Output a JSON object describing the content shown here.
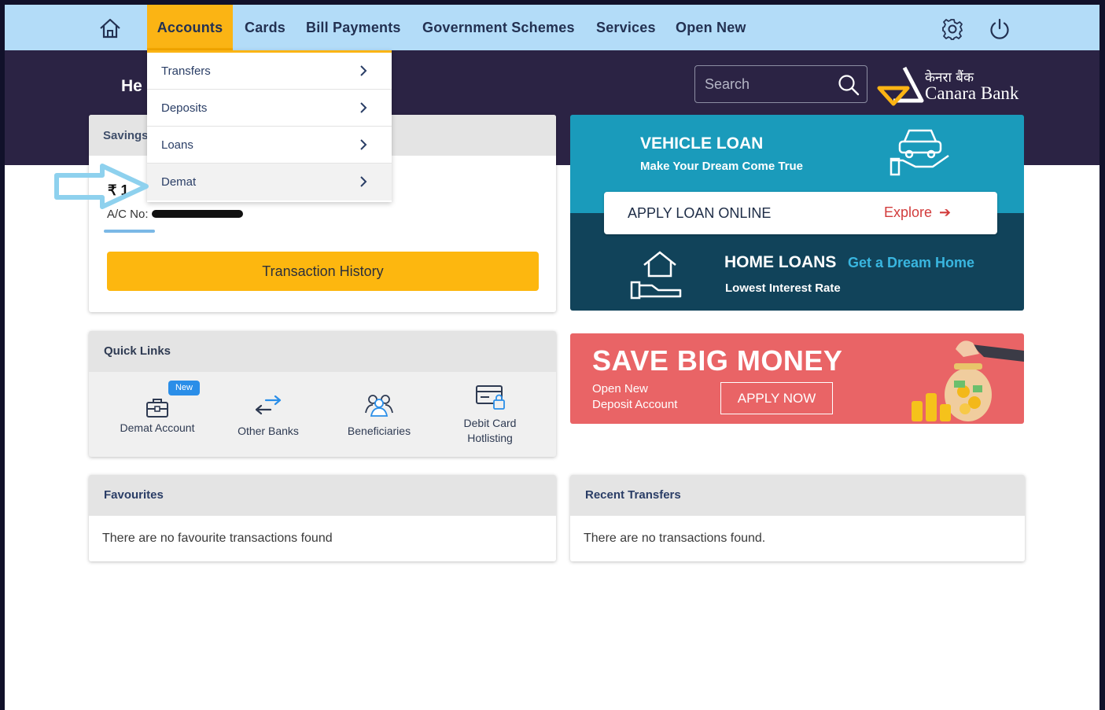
{
  "nav": {
    "items": [
      "Accounts",
      "Cards",
      "Bill Payments",
      "Government Schemes",
      "Services",
      "Open New"
    ]
  },
  "header": {
    "greeting": "He",
    "search_placeholder": "Search",
    "logo_hindi": "केनरा बैंक",
    "logo_english": "Canara Bank"
  },
  "accounts_menu": {
    "items": [
      "Transfers",
      "Deposits",
      "Loans",
      "Demat"
    ]
  },
  "savings_card": {
    "title": "Savings",
    "balance": "₹ 1",
    "account_label": "A/C No:",
    "transaction_history": "Transaction History"
  },
  "loan_banner": {
    "vehicle_title": "VEHICLE LOAN",
    "vehicle_subtitle": "Make Your Dream Come True",
    "apply_label": "APPLY LOAN ONLINE",
    "explore": "Explore",
    "home_title": "HOME LOANS",
    "home_tagline": "Get a Dream Home",
    "home_subtitle": "Lowest Interest Rate"
  },
  "save_banner": {
    "title": "SAVE BIG MONEY",
    "line1": "Open New",
    "line2": "Deposit Account",
    "button": "APPLY NOW"
  },
  "quick_links": {
    "title": "Quick Links",
    "badge": "New",
    "items": [
      {
        "label": "Demat Account",
        "icon": "briefcase-icon"
      },
      {
        "label": "Other Banks",
        "icon": "transfer-arrows-icon"
      },
      {
        "label": "Beneficiaries",
        "icon": "users-icon"
      },
      {
        "label": "Debit Card\nHotlisting",
        "icon": "card-lock-icon"
      }
    ]
  },
  "favourites": {
    "title": "Favourites",
    "empty": "There are no favourite transactions found"
  },
  "recent_transfers": {
    "title": "Recent Transfers",
    "empty": "There are no transactions found."
  },
  "colors": {
    "nav_bg": "#b3dcf8",
    "accent": "#fbb414",
    "band": "#2b2344",
    "loan_teal": "#1a9bbb",
    "loan_dark": "#11435a",
    "save_red": "#e96466"
  }
}
